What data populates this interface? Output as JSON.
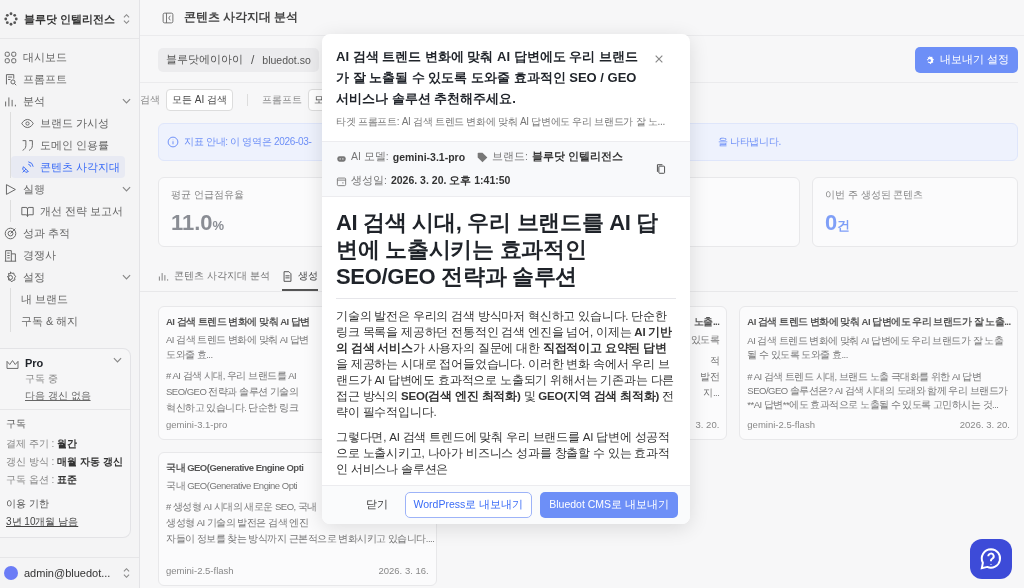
{
  "sidebar": {
    "brand": "블루닷 인텔리전스",
    "nav": [
      {
        "label": "대시보드",
        "selected": false
      },
      {
        "label": "프롬프트",
        "selected": false
      },
      {
        "label": "분석",
        "selected": false,
        "expanded": true,
        "children": [
          {
            "label": "브랜드 가시성",
            "selected": false
          },
          {
            "label": "도메인 인용률",
            "selected": false
          },
          {
            "label": "콘텐츠 사각지대",
            "selected": true
          }
        ]
      },
      {
        "label": "실행",
        "selected": false,
        "expanded": true,
        "children": [
          {
            "label": "개선 전략 보고서",
            "selected": false
          }
        ]
      },
      {
        "label": "성과 추적",
        "selected": false
      },
      {
        "label": "경쟁사",
        "selected": false
      },
      {
        "label": "설정",
        "selected": false,
        "expanded": true,
        "children": [
          {
            "label": "내 브랜드",
            "selected": false
          },
          {
            "label": "구독 & 해지",
            "selected": false
          }
        ]
      }
    ],
    "plan": {
      "name": "Pro",
      "status": "구독 중",
      "renewal": "다음 갱신 없음",
      "section": "구독",
      "rows": [
        {
          "label": "결제 주기 :",
          "value": "월간"
        },
        {
          "label": "갱신 방식 :",
          "value": "매월 자동 갱신"
        },
        {
          "label": "구독 옵션 :",
          "value": "표준"
        }
      ],
      "term_label": "이용 기한",
      "term": "3년 10개월 남음"
    },
    "user": "admin@bluedot..."
  },
  "header": {
    "title": "콘텐츠 사각지대 분석"
  },
  "toolbar": {
    "workspace": "블루닷에이아이",
    "separator": "/",
    "domain": "bluedot.so",
    "export_settings": "내보내기 설정"
  },
  "filters": [
    {
      "label": "검색",
      "value": "모든 AI 검색"
    },
    {
      "label": "프롬프트",
      "value": "모"
    }
  ],
  "notice": {
    "lead": "지표 안내: 이 영역은 2026-03-",
    "tail": "을 나타냅니다."
  },
  "stats": [
    {
      "label": "평균 언급점유율",
      "value": "11.0",
      "unit": "%",
      "color": "#8a8d94"
    },
    {
      "label": "이번 주 생성된 콘텐츠",
      "value": "0",
      "unit": "건",
      "color": "#7f9ff7"
    }
  ],
  "tabs": [
    {
      "label": "콘텐츠 사각지대 분석",
      "selected": false
    },
    {
      "label": "생성",
      "selected": true
    }
  ],
  "cards": [
    {
      "kind": "left",
      "title": "AI 검색 트렌드 변화에 맞춰 AI 답변",
      "subtitle": [
        "AI 검색 트렌드 변화에 맞춰 AI 답변",
        "도와줄 효..."
      ],
      "body": [
        "# AI 검색 시대, 우리 브랜드를 AI",
        "SEO/GEO 전략과 솔루션 기술의",
        "혁신하고 있습니다. 단순한 링크"
      ],
      "model": "gemini-3.1-pro"
    },
    {
      "kind": "right",
      "title": "노출...",
      "subtitle": [
        "있도록"
      ],
      "body": [
        "적",
        "발전",
        "지..."
      ],
      "date": "3. 20."
    },
    {
      "kind": "full",
      "title": "AI 검색 트렌드 변화에 맞춰 AI 답변에도 우리 브랜드가 잘 노출...",
      "subtitle": [
        "AI 검색 트렌드 변화에 맞춰 AI 답변에도 우리 브랜드가 잘 노출될 수 있도록 도와줄 효..."
      ],
      "body": [
        "# AI 검색 트렌드 시대, 브랜드 노출 극대화를 위한 AI 답변 SEO/GEO 솔루션은? AI 검색 시대의 도래와 함께 우리 브랜드가 **AI 답변**에도 효과적으로 노출될 수 있도록 고민하시는 것..."
      ],
      "model": "gemini-2.5-flash",
      "date": "2026. 3. 20."
    },
    {
      "kind": "left",
      "title": "국내 GEO(Generative Engine Opti",
      "subtitle": [
        "국내 GEO(Generative Engine Opti"
      ],
      "body": [
        "# 생성형 AI 시대의 새로운 SEO, 국내",
        "생성형 AI 기술의 발전은 검색 엔진",
        "자들이 정보를 찾는 방식까지 근본적으로 변화시키고 있습니다...."
      ],
      "model": "gemini-2.5-flash",
      "date": "2026. 3. 16."
    }
  ],
  "modal": {
    "title": "AI 검색 트렌드 변화에 맞춰 AI 답변에도 우리 브랜드가 잘 노출될 수 있도록 도와줄 효과적인 SEO / GEO 서비스나 솔루션 추천해주세요.",
    "target": "타겟 프롬프트: AI 검색 트렌드 변화에 맞춰 AI 답변에도 우리 브랜드가 잘 노...",
    "meta": [
      {
        "label": "AI 모델:",
        "value": "gemini-3.1-pro"
      },
      {
        "label": "브랜드:",
        "value": "블루닷 인텔리전스"
      },
      {
        "label": "생성일:",
        "value": "2026. 3. 20. 오후 1:41:50"
      }
    ],
    "heading": "AI 검색 시대, 우리 브랜드를 AI 답변에 노출시키는 효과적인 SEO/GEO 전략과 솔루션",
    "paragraphs": [
      "기술의 발전은 우리의 검색 방식마저 혁신하고 있습니다. 단순한 링크 목록을 제공하던 전통적인 검색 엔진을 넘어, 이제는 **AI 기반의 검색 서비스**가 사용자의 질문에 대한 **직접적이고 요약된 답변**을 제공하는 시대로 접어들었습니다. 이러한 변화 속에서 우리 브랜드가 AI 답변에도 효과적으로 노출되기 위해서는 기존과는 다른 접근 방식의 **SEO(검색 엔진 최적화)** 및 **GEO(지역 검색 최적화)** 전략이 필수적입니다.",
      "그렇다면, AI 검색 트렌드에 맞춰 우리 브랜드를 AI 답변에 성공적으로 노출시키고, 나아가 비즈니스 성과를 창출할 수 있는 효과적인 서비스나 솔루션은"
    ],
    "buttons": [
      {
        "label": "닫기",
        "kind": "text"
      },
      {
        "label": "WordPress로 내보내기",
        "kind": "outline"
      },
      {
        "label": "Bluedot CMS로 내보내기",
        "kind": "primary"
      }
    ]
  }
}
